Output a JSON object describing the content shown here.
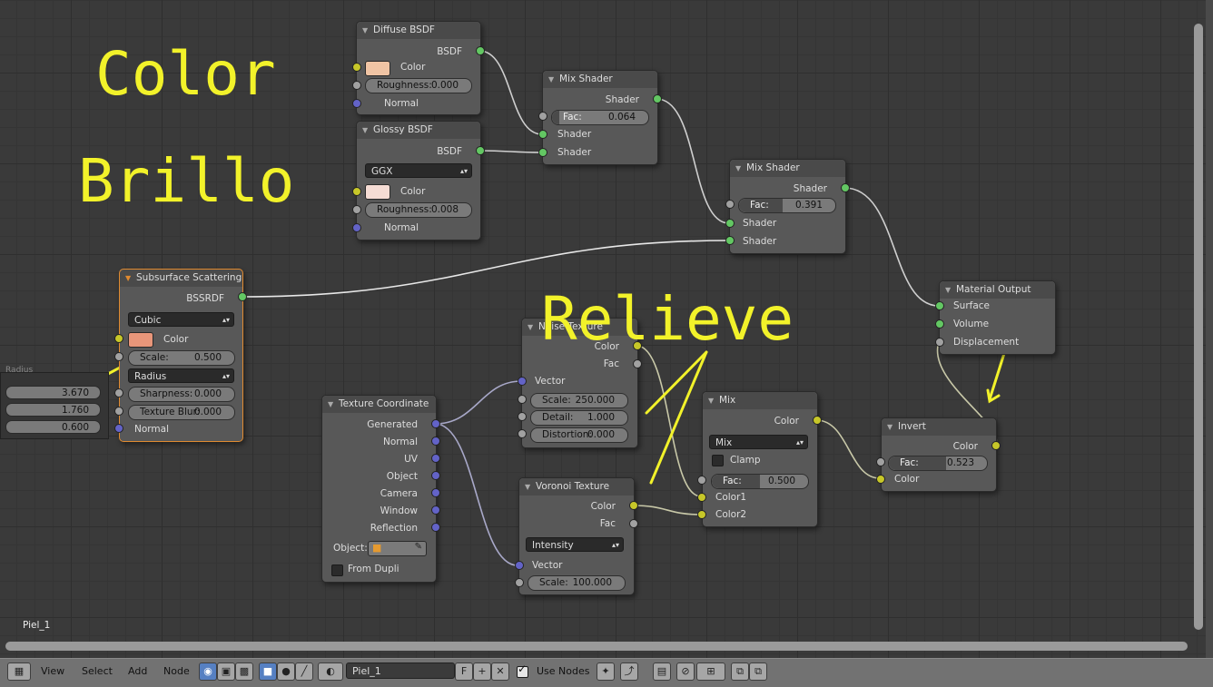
{
  "annotations": {
    "color": "Color",
    "brillo": "Brillo",
    "relieve": "Relieve",
    "arrow_glyph": "→"
  },
  "left_panel": {
    "header_label": "Radius",
    "values": [
      "3.670",
      "1.760",
      "0.600"
    ]
  },
  "nodes": {
    "diffuse": {
      "title": "Diffuse BSDF",
      "out_bsdf": "BSDF",
      "color_label": "Color",
      "color_hex": "#f0c4a4",
      "roughness_label": "Roughness:",
      "roughness_value": "0.000",
      "normal_label": "Normal"
    },
    "glossy": {
      "title": "Glossy BSDF",
      "out_bsdf": "BSDF",
      "distribution": "GGX",
      "color_label": "Color",
      "color_hex": "#f5dcd4",
      "roughness_label": "Roughness:",
      "roughness_value": "0.008",
      "normal_label": "Normal"
    },
    "mix1": {
      "title": "Mix Shader",
      "out_shader": "Shader",
      "fac_label": "Fac:",
      "fac_value": "0.064",
      "shader1": "Shader",
      "shader2": "Shader"
    },
    "mix2": {
      "title": "Mix Shader",
      "out_shader": "Shader",
      "fac_label": "Fac:",
      "fac_value": "0.391",
      "shader1": "Shader",
      "shader2": "Shader"
    },
    "output": {
      "title": "Material Output",
      "surface": "Surface",
      "volume": "Volume",
      "displacement": "Displacement"
    },
    "sss": {
      "title": "Subsurface Scattering",
      "out_bssrdf": "BSSRDF",
      "falloff": "Cubic",
      "color_label": "Color",
      "color_hex": "#e8967a",
      "scale_label": "Scale:",
      "scale_value": "0.500",
      "radius_label": "Radius",
      "sharpness_label": "Sharpness:",
      "sharpness_value": "0.000",
      "blur_label": "Texture Blur:",
      "blur_value": "0.000",
      "normal_label": "Normal"
    },
    "noise": {
      "title": "Noise Texture",
      "out_color": "Color",
      "out_fac": "Fac",
      "vector_label": "Vector",
      "scale_label": "Scale:",
      "scale_value": "250.000",
      "detail_label": "Detail:",
      "detail_value": "1.000",
      "distortion_label": "Distortion:",
      "distortion_value": "0.000"
    },
    "texcoord": {
      "title": "Texture Coordinate",
      "outputs": [
        "Generated",
        "Normal",
        "UV",
        "Object",
        "Camera",
        "Window",
        "Reflection"
      ],
      "object_label": "Object:",
      "from_dupli": "From Dupli"
    },
    "voronoi": {
      "title": "Voronoi Texture",
      "out_color": "Color",
      "out_fac": "Fac",
      "coloring": "Intensity",
      "vector_label": "Vector",
      "scale_label": "Scale:",
      "scale_value": "100.000"
    },
    "mixrgb": {
      "title": "Mix",
      "out_color": "Color",
      "blend": "Mix",
      "clamp": "Clamp",
      "fac_label": "Fac:",
      "fac_value": "0.500",
      "color1": "Color1",
      "color2": "Color2"
    },
    "invert": {
      "title": "Invert",
      "out_color": "Color",
      "fac_label": "Fac:",
      "fac_value": "0.523",
      "in_color": "Color"
    }
  },
  "material_name_overlay": "Piel_1",
  "toolbar": {
    "menu_view": "View",
    "menu_select": "Select",
    "menu_add": "Add",
    "menu_node": "Node",
    "material_name": "Piel_1",
    "fake_user": "F",
    "use_nodes_label": "Use Nodes"
  }
}
